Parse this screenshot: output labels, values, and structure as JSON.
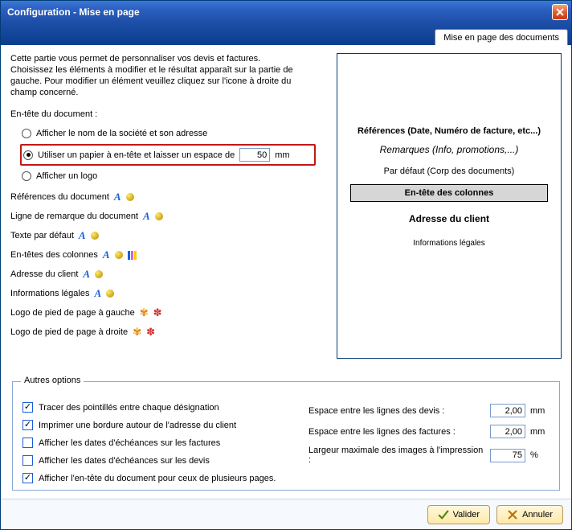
{
  "window": {
    "title": "Configuration - Mise en page",
    "tab": "Mise en page des documents"
  },
  "intro": {
    "p1": "Cette partie vous permet de personnaliser vos devis et factures.",
    "p2": "Choisissez les éléments à modifier et le résultat apparaît sur la partie de gauche. Pour modifier un élément veuillez cliquez sur l'icone à droite du champ concerné."
  },
  "header_section": {
    "label": "En-tête du document :",
    "radios": {
      "showCompany": "Afficher le nom de la société et son adresse",
      "usePaper_prefix": "Utiliser un papier à en-tête et laisser un espace de",
      "usePaper_value": "50",
      "usePaper_unit": "mm",
      "showLogo": "Afficher un logo"
    },
    "options": {
      "docRefs": "Références du document",
      "remarkLine": "Ligne de remarque du document",
      "defaultText": "Texte par défaut",
      "colHeaders": "En-têtes des colonnes",
      "clientAddress": "Adresse du client",
      "legalInfo": "Informations légales",
      "footerLogoLeft": "Logo de pied de page à gauche",
      "footerLogoRight": "Logo de pied de page à droite"
    }
  },
  "preview": {
    "refs": "Références (Date, Numéro de facture, etc...)",
    "remarks": "Remarques (Info, promotions,...)",
    "default": "Par défaut (Corp des documents)",
    "colHeader": "En-tête des colonnes",
    "clientAddress": "Adresse du client",
    "legal": "Informations légales"
  },
  "other": {
    "legend": "Autres options",
    "chk": {
      "dots": "Tracer des pointillés entre chaque désignation",
      "border": "Imprimer une bordure autour de l'adresse du client",
      "invoiceDates": "Afficher les dates d'échéances sur les factures",
      "quoteDates": "Afficher les dates d'échéances sur les devis",
      "multipage": "Afficher l'en-tête du document pour ceux de plusieurs pages."
    },
    "spacing": {
      "devisLabel": "Espace entre les lignes des devis :",
      "devisValue": "2,00",
      "devisUnit": "mm",
      "factLabel": "Espace entre les lignes des factures :",
      "factValue": "2,00",
      "factUnit": "mm",
      "imgLabel": "Largeur maximale des images à l'impression :",
      "imgValue": "75",
      "imgUnit": "%"
    }
  },
  "footer": {
    "ok": "Valider",
    "cancel": "Annuler"
  }
}
